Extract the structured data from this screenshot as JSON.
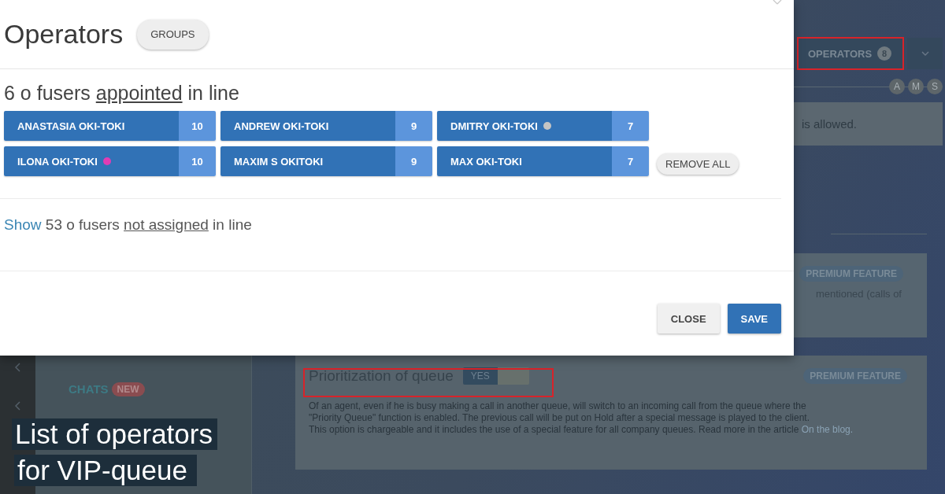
{
  "background": {
    "nav_items": [
      {
        "label": "CHATS",
        "badge": "NEW"
      }
    ],
    "operators_tab": {
      "label": "OPERATORS",
      "count": "8"
    },
    "role_circles": [
      "A",
      "M",
      "S"
    ],
    "notice": "is allowed.",
    "cards": [
      {
        "badge": "PREMIUM FEATURE",
        "text": "mentioned (calls of"
      },
      {
        "title": "Prioritization of queue",
        "toggle": {
          "label": "YES",
          "on": true
        },
        "badge": "PREMIUM FEATURE",
        "text_lines": [
          "Of an agent, even if he is busy making a call in another queue, will switch to an incoming call from the queue where the",
          "\"Priority Queue\" function is enabled. The previous call will be put on Hold after a special message is played to the client.",
          "This option is chargeable and it includes the use of a special feature for all company queues. Read more in the article"
        ],
        "link": "On the blog."
      }
    ]
  },
  "modal": {
    "title": "Operators",
    "groups_button": "GROUPS",
    "assigned": {
      "before": "6 o fusers",
      "underlined": "appointed",
      "after": "in line"
    },
    "operators": [
      {
        "name": "ANASTASIA OKI-TOKI",
        "count": "10"
      },
      {
        "name": "ANDREW OKI-TOKI",
        "count": "9"
      },
      {
        "name": "DMITRY OKI-TOKI",
        "count": "7",
        "color": "#c4c4c4"
      },
      {
        "name": "ILONA OKI-TOKI",
        "count": "10",
        "color": "#e03cb4"
      },
      {
        "name": "MAXIM S OKITOKI",
        "count": "9"
      },
      {
        "name": "MAX OKI-TOKI",
        "count": "7"
      }
    ],
    "remove_all": "REMOVE ALL",
    "unassigned": {
      "link": "Show",
      "before": "53 o fusers",
      "underlined": "not assigned",
      "after": "in line"
    },
    "close_button": "CLOSE",
    "save_button": "SAVE"
  },
  "caption": [
    "List of operators",
    "for VIP-queue"
  ]
}
